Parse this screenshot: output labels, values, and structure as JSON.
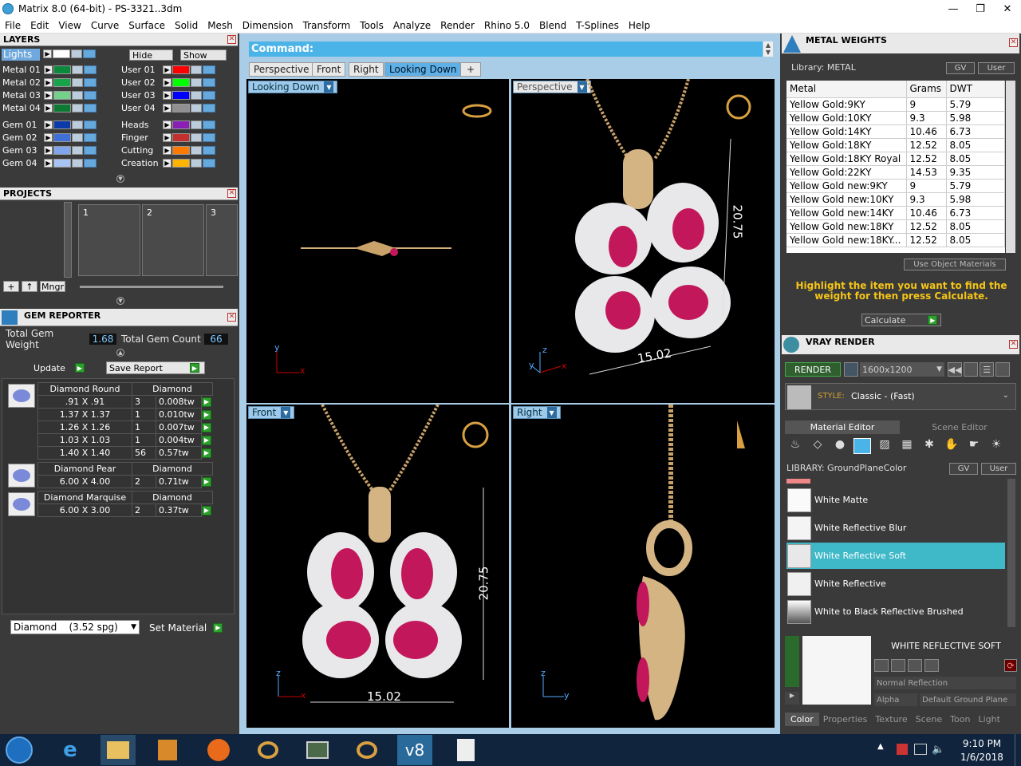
{
  "window": {
    "title": "Matrix 8.0 (64-bit) - PS-3321..3dm",
    "min": "—",
    "max": "❐",
    "close": "✕"
  },
  "menu": [
    "File",
    "Edit",
    "View",
    "Curve",
    "Surface",
    "Solid",
    "Mesh",
    "Dimension",
    "Transform",
    "Tools",
    "Analyze",
    "Render",
    "Rhino 5.0",
    "Blend",
    "T-Splines",
    "Help"
  ],
  "layers": {
    "title": "LAYERS",
    "lights": "Lights",
    "hide": "Hide",
    "show": "Show",
    "left": [
      {
        "name": "Metal 01",
        "color": "#0a8a3a"
      },
      {
        "name": "Metal 02",
        "color": "#17a34a"
      },
      {
        "name": "Metal 03",
        "color": "#74d08a"
      },
      {
        "name": "Metal 04",
        "color": "#0c7a33"
      },
      {
        "name": "Gem 01",
        "color": "#0c3aa8"
      },
      {
        "name": "Gem 02",
        "color": "#3f70d8"
      },
      {
        "name": "Gem 03",
        "color": "#7fa6ec"
      },
      {
        "name": "Gem 04",
        "color": "#a7c4f4"
      }
    ],
    "right": [
      {
        "name": "User 01",
        "color": "#ff0000"
      },
      {
        "name": "User 02",
        "color": "#00ff00"
      },
      {
        "name": "User 03",
        "color": "#0000ff"
      },
      {
        "name": "User 04",
        "color": "#909090"
      },
      {
        "name": "Heads",
        "color": "#8a1fb4"
      },
      {
        "name": "Finger",
        "color": "#c43030"
      },
      {
        "name": "Cutting",
        "color": "#ff7a00"
      },
      {
        "name": "Creation",
        "color": "#ffb400"
      }
    ]
  },
  "projects": {
    "title": "PROJECTS",
    "slots": [
      "1",
      "2",
      "3"
    ],
    "mngr": "Mngr"
  },
  "gem_reporter": {
    "title": "GEM REPORTER",
    "total_weight_label": "Total Gem Weight",
    "total_weight": "1.68",
    "total_count_label": "Total Gem Count",
    "total_count": "66",
    "update": "Update",
    "save_report": "Save Report",
    "groups": [
      {
        "shape": "Diamond Round",
        "material": "Diamond",
        "rows": [
          [
            ".91 X .91",
            "3",
            "0.008tw"
          ],
          [
            "1.37 X 1.37",
            "1",
            "0.010tw"
          ],
          [
            "1.26 X 1.26",
            "1",
            "0.007tw"
          ],
          [
            "1.03 X 1.03",
            "1",
            "0.004tw"
          ],
          [
            "1.40 X 1.40",
            "56",
            "0.57tw"
          ]
        ]
      },
      {
        "shape": "Diamond Pear",
        "material": "Diamond",
        "rows": [
          [
            "6.00 X 4.00",
            "2",
            "0.71tw"
          ]
        ]
      },
      {
        "shape": "Diamond Marquise",
        "material": "Diamond",
        "rows": [
          [
            "6.00 X 3.00",
            "2",
            "0.37tw"
          ]
        ]
      }
    ],
    "material_select": "Diamond    (3.52 spg)",
    "set_material": "Set Material"
  },
  "command": {
    "label": "Command:"
  },
  "tabs": [
    "Perspective",
    "Front",
    "Right",
    "Looking Down",
    "+"
  ],
  "viewports": {
    "top_left": "Looking Down",
    "top_right": "Perspective",
    "bottom_left": "Front",
    "bottom_right": "Right",
    "dims": {
      "persp_h": "20.75",
      "persp_w": "15.02",
      "front_h": "20.75",
      "front_w": "15.02"
    },
    "axes": {
      "x": "x",
      "y": "y",
      "z": "z"
    }
  },
  "metal_weights": {
    "title": "METAL WEIGHTS",
    "library": "Library: METAL",
    "gv": "GV",
    "user": "User",
    "headers": [
      "Metal",
      "Grams",
      "DWT"
    ],
    "rows": [
      [
        "Yellow Gold:9KY",
        "9",
        "5.79"
      ],
      [
        "Yellow Gold:10KY",
        "9.3",
        "5.98"
      ],
      [
        "Yellow Gold:14KY",
        "10.46",
        "6.73"
      ],
      [
        "Yellow Gold:18KY",
        "12.52",
        "8.05"
      ],
      [
        "Yellow Gold:18KY Royal",
        "12.52",
        "8.05"
      ],
      [
        "Yellow Gold:22KY",
        "14.53",
        "9.35"
      ],
      [
        "Yellow Gold new:9KY",
        "9",
        "5.79"
      ],
      [
        "Yellow Gold new:10KY",
        "9.3",
        "5.98"
      ],
      [
        "Yellow Gold new:14KY",
        "10.46",
        "6.73"
      ],
      [
        "Yellow Gold new:18KY",
        "12.52",
        "8.05"
      ],
      [
        "Yellow Gold new:18KY...",
        "12.52",
        "8.05"
      ]
    ],
    "use_object": "Use Object Materials",
    "hint": "Highlight the item you want to find the weight for then press Calculate.",
    "calculate": "Calculate"
  },
  "vray": {
    "title": "VRAY RENDER",
    "render": "RENDER",
    "resolution": "1600x1200",
    "style_label": "STYLE:",
    "style": "Classic - (Fast)",
    "tab_material": "Material Editor",
    "tab_scene": "Scene Editor",
    "library": "LIBRARY: GroundPlaneColor",
    "gv": "GV",
    "user": "User",
    "materials": [
      {
        "name": "White Matte",
        "selected": false
      },
      {
        "name": "White Reflective Blur",
        "selected": false
      },
      {
        "name": "White Reflective Soft",
        "selected": true
      },
      {
        "name": "White Reflective",
        "selected": false
      },
      {
        "name": "White to Black Reflective Brushed",
        "selected": false
      }
    ],
    "preview_title": "WHITE REFLECTIVE SOFT",
    "reflection": "Normal Reflection",
    "alpha": "Alpha",
    "ground": "Default Ground Plane",
    "bottom_tabs": [
      "Color",
      "Properties",
      "Texture",
      "Scene",
      "Toon",
      "Light"
    ]
  },
  "taskbar": {
    "time": "9:10 PM",
    "date": "1/6/2018"
  }
}
